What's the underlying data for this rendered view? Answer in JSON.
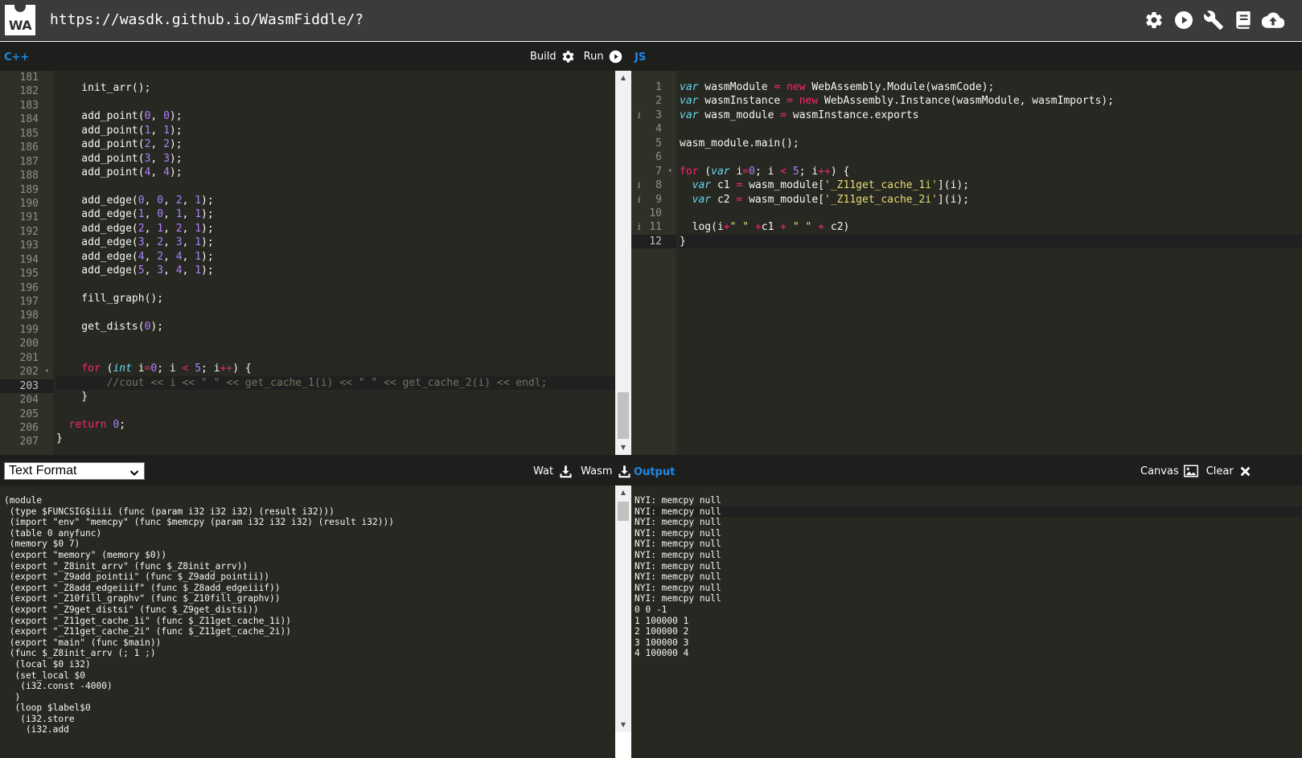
{
  "topbar": {
    "logo_text": "WA",
    "url": "https://wasdk.github.io/WasmFiddle/?",
    "icons": [
      "gear-icon",
      "play-icon",
      "wrench-icon",
      "book-icon",
      "cloud-upload-icon"
    ]
  },
  "cpp": {
    "title": "C++",
    "build_label": "Build",
    "run_label": "Run",
    "lines": [
      {
        "num": "181",
        "code": ""
      },
      {
        "num": "182",
        "code": "    init_arr();"
      },
      {
        "num": "183",
        "code": ""
      },
      {
        "num": "184",
        "code": "    add_point(0, 0);"
      },
      {
        "num": "185",
        "code": "    add_point(1, 1);"
      },
      {
        "num": "186",
        "code": "    add_point(2, 2);"
      },
      {
        "num": "187",
        "code": "    add_point(3, 3);"
      },
      {
        "num": "188",
        "code": "    add_point(4, 4);"
      },
      {
        "num": "189",
        "code": ""
      },
      {
        "num": "190",
        "code": "    add_edge(0, 0, 2, 1);"
      },
      {
        "num": "191",
        "code": "    add_edge(1, 0, 1, 1);"
      },
      {
        "num": "192",
        "code": "    add_edge(2, 1, 2, 1);"
      },
      {
        "num": "193",
        "code": "    add_edge(3, 2, 3, 1);"
      },
      {
        "num": "194",
        "code": "    add_edge(4, 2, 4, 1);"
      },
      {
        "num": "195",
        "code": "    add_edge(5, 3, 4, 1);"
      },
      {
        "num": "196",
        "code": ""
      },
      {
        "num": "197",
        "code": "    fill_graph();"
      },
      {
        "num": "198",
        "code": ""
      },
      {
        "num": "199",
        "code": "    get_dists(0);"
      },
      {
        "num": "200",
        "code": ""
      },
      {
        "num": "201",
        "code": ""
      },
      {
        "num": "202",
        "code": "    for (int i=0; i < 5; i++) {"
      },
      {
        "num": "203",
        "code": "        //cout << i << \" \" << get_cache_1(i) << \" \" << get_cache_2(i) << endl;"
      },
      {
        "num": "204",
        "code": "    }"
      },
      {
        "num": "205",
        "code": ""
      },
      {
        "num": "206",
        "code": "  return 0;"
      },
      {
        "num": "207",
        "code": "}"
      }
    ]
  },
  "js": {
    "title": "JS",
    "lines": [
      {
        "num": "1",
        "code": "var wasmModule = new WebAssembly.Module(wasmCode);"
      },
      {
        "num": "2",
        "code": "var wasmInstance = new WebAssembly.Instance(wasmModule, wasmImports);"
      },
      {
        "num": "3",
        "code": "var wasm_module = wasmInstance.exports"
      },
      {
        "num": "4",
        "code": ""
      },
      {
        "num": "5",
        "code": "wasm_module.main();"
      },
      {
        "num": "6",
        "code": ""
      },
      {
        "num": "7",
        "code": "for (var i=0; i < 5; i++) {"
      },
      {
        "num": "8",
        "code": "  var c1 = wasm_module['_Z11get_cache_1i'](i);"
      },
      {
        "num": "9",
        "code": "  var c2 = wasm_module['_Z11get_cache_2i'](i);"
      },
      {
        "num": "10",
        "code": ""
      },
      {
        "num": "11",
        "code": "  log(i+\" \" +c1 + \" \" + c2)"
      },
      {
        "num": "12",
        "code": "}"
      }
    ]
  },
  "wat": {
    "format_selected": "Text Format",
    "wat_label": "Wat",
    "wasm_label": "Wasm",
    "lines": [
      "(module",
      " (type $FUNCSIG$iiii (func (param i32 i32 i32) (result i32)))",
      " (import \"env\" \"memcpy\" (func $memcpy (param i32 i32 i32) (result i32)))",
      " (table 0 anyfunc)",
      " (memory $0 7)",
      " (export \"memory\" (memory $0))",
      " (export \"_Z8init_arrv\" (func $_Z8init_arrv))",
      " (export \"_Z9add_pointii\" (func $_Z9add_pointii))",
      " (export \"_Z8add_edgeiiif\" (func $_Z8add_edgeiiif))",
      " (export \"_Z10fill_graphv\" (func $_Z10fill_graphv))",
      " (export \"_Z9get_distsi\" (func $_Z9get_distsi))",
      " (export \"_Z11get_cache_1i\" (func $_Z11get_cache_1i))",
      " (export \"_Z11get_cache_2i\" (func $_Z11get_cache_2i))",
      " (export \"main\" (func $main))",
      " (func $_Z8init_arrv (; 1 ;)",
      "  (local $0 i32)",
      "  (set_local $0",
      "   (i32.const -4000)",
      "  )",
      "  (loop $label$0",
      "   (i32.store",
      "    (i32.add"
    ]
  },
  "output": {
    "title": "Output",
    "canvas_label": "Canvas",
    "clear_label": "Clear",
    "lines": [
      "NYI: memcpy null",
      "NYI: memcpy null",
      "NYI: memcpy null",
      "NYI: memcpy null",
      "NYI: memcpy null",
      "NYI: memcpy null",
      "NYI: memcpy null",
      "NYI: memcpy null",
      "NYI: memcpy null",
      "NYI: memcpy null",
      "0 0 -1",
      "1 100000 1",
      "2 100000 2",
      "3 100000 3",
      "4 100000 4"
    ]
  }
}
